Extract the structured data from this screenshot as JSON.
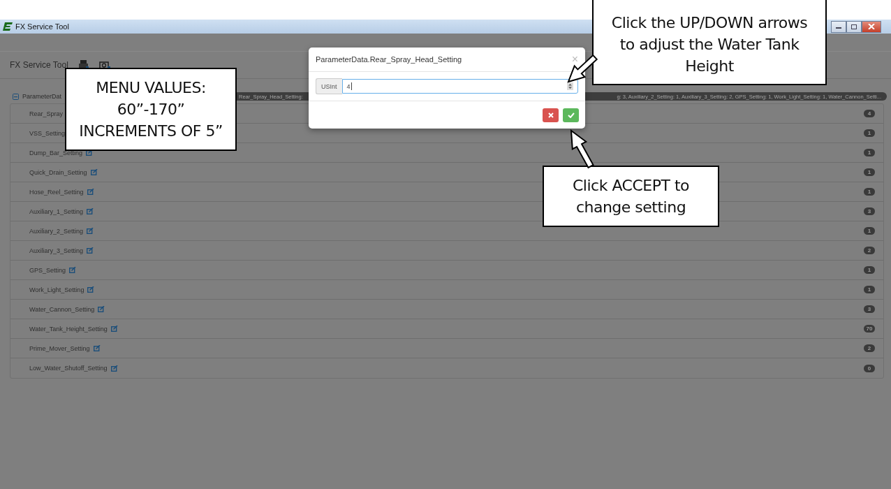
{
  "title_bar": {
    "title": "FX Service Tool"
  },
  "header": {
    "title": "FX Service Tool"
  },
  "tree": {
    "root": {
      "label": "ParameterDat",
      "expanded": true,
      "summary_left": "Rear_Spray_Head_Setting:",
      "summary_right": "g: 3, Auxiliary_2_Setting: 1, Auxiliary_3_Setting: 2, GPS_Setting: 1, Work_Light_Setting: 1, Water_Cannon_Setti..."
    },
    "items": [
      {
        "label": "Rear_Spray",
        "edit_icon": false,
        "value": "4"
      },
      {
        "label": "VSS_Setting",
        "edit_icon": false,
        "value": "1"
      },
      {
        "label": "Dump_Bar_Setting",
        "edit_icon": true,
        "value": "1"
      },
      {
        "label": "Quick_Drain_Setting",
        "edit_icon": true,
        "value": "1"
      },
      {
        "label": "Hose_Reel_Setting",
        "edit_icon": true,
        "value": "1"
      },
      {
        "label": "Auxiliary_1_Setting",
        "edit_icon": true,
        "value": "3"
      },
      {
        "label": "Auxiliary_2_Setting",
        "edit_icon": true,
        "value": "1"
      },
      {
        "label": "Auxiliary_3_Setting",
        "edit_icon": true,
        "value": "2"
      },
      {
        "label": "GPS_Setting",
        "edit_icon": true,
        "value": "1"
      },
      {
        "label": "Work_Light_Setting",
        "edit_icon": true,
        "value": "1"
      },
      {
        "label": "Water_Cannon_Setting",
        "edit_icon": true,
        "value": "3"
      },
      {
        "label": "Water_Tank_Height_Setting",
        "edit_icon": true,
        "value": "70"
      },
      {
        "label": "Prime_Mover_Setting",
        "edit_icon": true,
        "value": "2"
      },
      {
        "label": "Low_Water_Shutoff_Setting",
        "edit_icon": true,
        "value": "0"
      }
    ]
  },
  "dialog": {
    "title": "ParameterData.Rear_Spray_Head_Setting",
    "close": "×",
    "type_label": "USInt",
    "value": "4"
  },
  "callouts": [
    {
      "kind": "left",
      "text": "MENU VALUES:\n60”-170”\nINCREMENTS OF 5”"
    },
    {
      "kind": "top",
      "text": "Click the UP/DOWN arrows\nto adjust the Water Tank\nHeight"
    },
    {
      "kind": "bottom",
      "text": "Click ACCEPT to\nchange setting"
    }
  ]
}
